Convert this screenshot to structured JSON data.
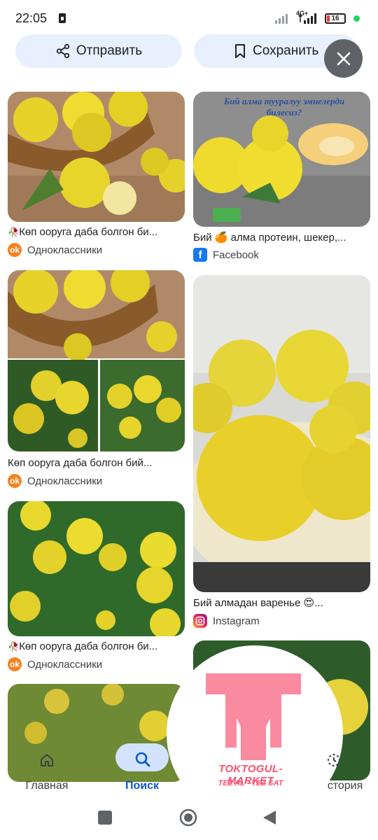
{
  "status_bar": {
    "time": "22:05",
    "network": "4G+",
    "battery": "16"
  },
  "actions": {
    "share_label": "Отправить",
    "save_label": "Сохранить"
  },
  "cards": [
    {
      "image_title": "",
      "caption": "Көп ооруга даба болгон би...",
      "source": "Одноклассники",
      "source_icon": "odnoklassniki-icon"
    },
    {
      "image_title": "Бий алма тууралуу эмнелерди билесиз?",
      "caption": "Бий 🍊 алма протеин, шекер,...",
      "source": "Facebook",
      "source_icon": "facebook-icon"
    },
    {
      "image_title": "",
      "caption": "Көп ооруга даба болгон бий...",
      "source": "Одноклассники",
      "source_icon": "odnoklassniki-icon"
    },
    {
      "image_title": "",
      "caption": "Бий алмадан варенье 😍...",
      "source": "Instagram",
      "source_icon": "instagram-icon"
    },
    {
      "image_title": "",
      "caption": "Көп ооруга даба болгон би...",
      "source": "Одноклассники",
      "source_icon": "odnoklassniki-icon"
    }
  ],
  "bottom_nav": {
    "items": [
      {
        "label": "Главная",
        "icon": "home-icon"
      },
      {
        "label": "Поиск",
        "icon": "search-icon",
        "active": true
      },
      {
        "label": "История",
        "icon": "history-icon"
      }
    ],
    "history_visible_label": "стория"
  },
  "watermark": {
    "letter": "T",
    "line1": "TOKTOGUL- MARKET",
    "line2": "TEZ AL - TEZ SAT"
  },
  "colors": {
    "accent": "#0b57d0",
    "pill_bg": "#e8f0fe",
    "nav_active_bg": "#d3e3fd",
    "watermark": "#ff4f6d",
    "odnoklassniki": "#f58220",
    "facebook": "#1877f2"
  }
}
